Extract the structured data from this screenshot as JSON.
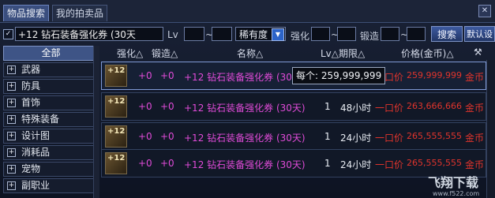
{
  "tabs": [
    {
      "label": "物品搜索"
    },
    {
      "label": "我的拍卖品"
    }
  ],
  "filter": {
    "search_value": "+12 钻石装备强化券 (30天",
    "lv_label": "Lv",
    "tilde1": "~",
    "rarity_value": "稀有度",
    "reinforce_label": "强化",
    "tilde2": "~",
    "forge_label": "锻造",
    "tilde3": "~",
    "search_btn": "搜索",
    "default_btn": "默认设"
  },
  "sidebar": {
    "items": [
      {
        "label": "全部"
      },
      {
        "label": "武器"
      },
      {
        "label": "防具"
      },
      {
        "label": "首饰"
      },
      {
        "label": "特殊装备"
      },
      {
        "label": "设计图"
      },
      {
        "label": "消耗品"
      },
      {
        "label": "宠物"
      },
      {
        "label": "副职业"
      }
    ]
  },
  "columns": {
    "reinforce": "强化△",
    "forge": "锻造△",
    "name": "名称△",
    "lv_period": "Lv△期限△",
    "price": "价格(金币)△"
  },
  "rows": [
    {
      "thumb": "+12",
      "reinforce": "+0",
      "forge": "+0",
      "name": "+12 钻石装备强化券 (30天)",
      "lv": "",
      "period": "",
      "price_type": "一口价",
      "price": "259,999,999",
      "currency": "金币"
    },
    {
      "thumb": "+12",
      "reinforce": "+0",
      "forge": "+0",
      "name": "+12 钻石装备强化券 (30天)",
      "lv": "1",
      "period": "48小时",
      "price_type": "一口价",
      "price": "263,666,666",
      "currency": "金币"
    },
    {
      "thumb": "+12",
      "reinforce": "+0",
      "forge": "+0",
      "name": "+12 钻石装备强化券 (30天)",
      "lv": "1",
      "period": "24小时",
      "price_type": "一口价",
      "price": "265,555,555",
      "currency": "金币"
    },
    {
      "thumb": "+12",
      "reinforce": "+0",
      "forge": "+0",
      "name": "+12 钻石装备强化券 (30天)",
      "lv": "1",
      "period": "24小时",
      "price_type": "一口价",
      "price": "265,555,555",
      "currency": "金币"
    }
  ],
  "tooltip": "每个: 259,999,999",
  "watermark": {
    "brand": "飞翔下载",
    "url": "www.f522.com"
  },
  "colors": {
    "accent": "#3e5486",
    "enhance": "#e04bd8",
    "price": "#e0342c"
  }
}
